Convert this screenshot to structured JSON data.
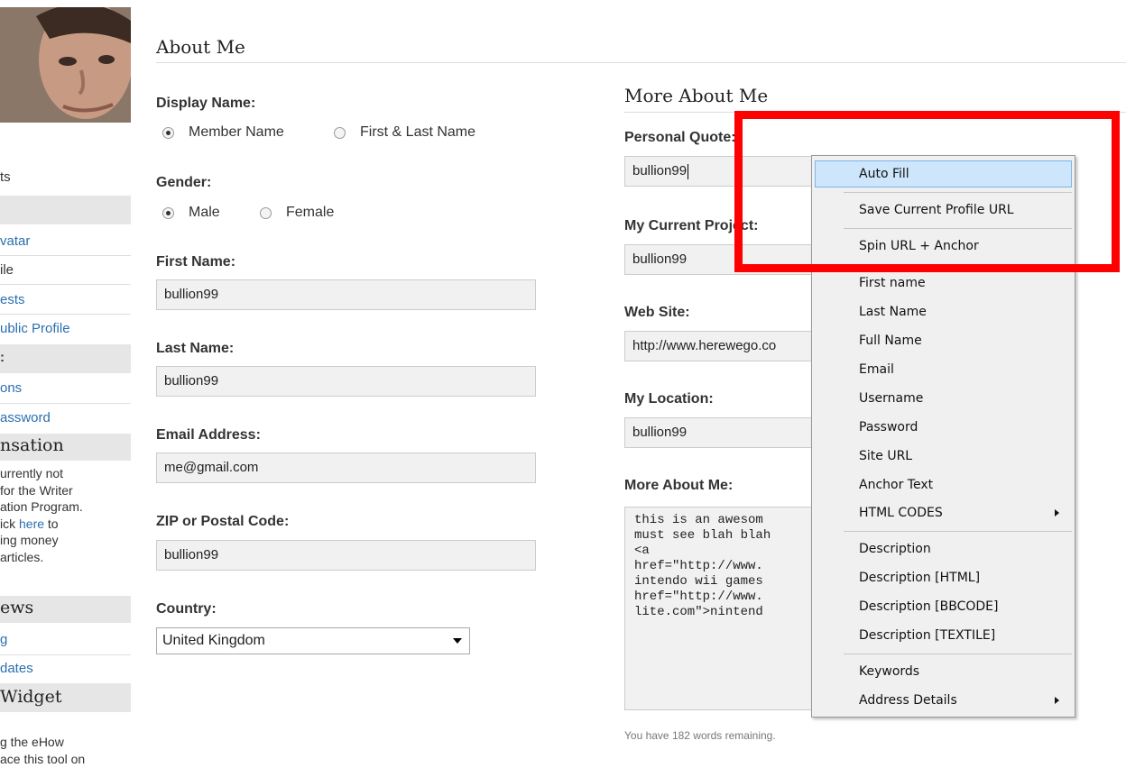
{
  "sidebar": {
    "fragments": {
      "ts": "ts",
      "avatar": "vatar",
      "profile": "ile",
      "interests": "ests",
      "public_profile": "ublic Profile",
      "colon": ":",
      "ons": "ons",
      "password": "assword",
      "compensation_head": "nsation",
      "comp_text_1": "urrently not",
      "comp_text_2": " for the Writer",
      "comp_text_3": "ation Program.",
      "comp_text_4a": "ick ",
      "comp_text_4_link": "here",
      "comp_text_4b": " to",
      "comp_text_5": "ing money",
      "comp_text_6": "articles.",
      "news_head": "ews",
      "news_link_1": "g",
      "news_link_2": "dates",
      "widget_head": " Widget",
      "widget_text_1": "g the eHow",
      "widget_text_2": "ace this tool on"
    }
  },
  "main": {
    "title": "About Me",
    "display_name": {
      "label": "Display Name:",
      "options": [
        "Member Name",
        "First & Last Name"
      ],
      "selected": "Member Name"
    },
    "gender": {
      "label": "Gender:",
      "options": [
        "Male",
        "Female"
      ],
      "selected": "Male"
    },
    "first_name": {
      "label": "First Name:",
      "value": "bullion99"
    },
    "last_name": {
      "label": "Last Name:",
      "value": "bullion99"
    },
    "email": {
      "label": "Email Address:",
      "value": "me@gmail.com"
    },
    "zip": {
      "label": "ZIP or Postal Code:",
      "value": "bullion99"
    },
    "country": {
      "label": "Country:",
      "value": "United Kingdom"
    }
  },
  "more": {
    "title": "More About Me",
    "quote": {
      "label": "Personal Quote:",
      "value": "bullion99"
    },
    "project": {
      "label": "My Current Project:",
      "value": "bullion99"
    },
    "website": {
      "label": "Web Site:",
      "value": "http://www.herewego.co"
    },
    "location": {
      "label": "My Location:",
      "value": "bullion99"
    },
    "about": {
      "label": "More About Me:",
      "value": "this is an awesom\nmust see blah blah\n<a\nhref=\"http://www.\nintendo wii games\nhref=\"http://www.\nlite.com\">nintend"
    },
    "remaining": "You have 182 words remaining."
  },
  "context_menu": {
    "items": [
      {
        "label": "Auto Fill"
      },
      {
        "label": "Save Current Profile URL"
      },
      {
        "label": "Spin URL + Anchor"
      },
      {
        "label": "First name"
      },
      {
        "label": "Last Name"
      },
      {
        "label": "Full Name"
      },
      {
        "label": "Email"
      },
      {
        "label": "Username"
      },
      {
        "label": "Password"
      },
      {
        "label": "Site URL"
      },
      {
        "label": "Anchor Text"
      },
      {
        "label": "HTML CODES"
      },
      {
        "label": "Description"
      },
      {
        "label": "Description [HTML]"
      },
      {
        "label": "Description [BBCODE]"
      },
      {
        "label": "Description [TEXTILE]"
      },
      {
        "label": "Keywords"
      },
      {
        "label": "Address Details"
      }
    ]
  },
  "colors": {
    "highlight_box": "#ff0000",
    "link": "#2a6fb0",
    "menu_highlight": "#cde6fb"
  }
}
